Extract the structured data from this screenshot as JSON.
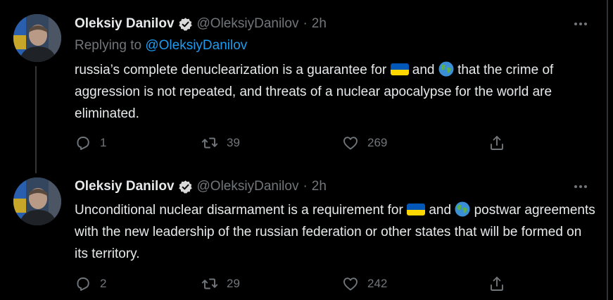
{
  "tweets": [
    {
      "author": {
        "name": "Oleksiy Danilov",
        "handle": "@OleksiyDanilov",
        "separator": "·",
        "time": "2h",
        "verified": true
      },
      "replying": {
        "prefix": "Replying to",
        "mention": "@OleksiyDanilov"
      },
      "text": {
        "part1": "russia’s complete denuclearization is a guarantee for",
        "part2": "and",
        "part3": "that the crime of aggression is not repeated, and threats of a nuclear apocalypse for the world are eliminated."
      },
      "actions": {
        "replies": "1",
        "retweets": "39",
        "likes": "269"
      }
    },
    {
      "author": {
        "name": "Oleksiy Danilov",
        "handle": "@OleksiyDanilov",
        "separator": "·",
        "time": "2h",
        "verified": true
      },
      "text": {
        "part1": "Unconditional nuclear disarmament is a requirement for",
        "part2": "and",
        "part3": "postwar agreements with the new leadership of the russian federation or other states that will be formed on its territory."
      },
      "actions": {
        "replies": "2",
        "retweets": "29",
        "likes": "242"
      }
    }
  ],
  "icons": {
    "verified": "verified-badge-icon",
    "more": "more-options-icon",
    "reply": "reply-icon",
    "retweet": "retweet-icon",
    "like": "heart-icon",
    "share": "share-icon",
    "flag": "ukraine-flag-emoji",
    "globe": "globe-emoji"
  },
  "colors": {
    "background": "#000000",
    "text": "#e7e9ea",
    "secondary": "#71767b",
    "link": "#1d9bf0",
    "flag_blue": "#0057b7",
    "flag_yellow": "#ffd700"
  }
}
